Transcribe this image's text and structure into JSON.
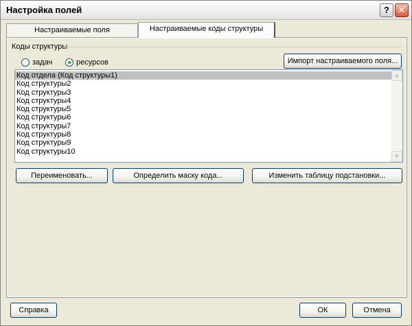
{
  "window": {
    "title": "Настройка полей",
    "help_glyph": "?",
    "close_glyph": "✕"
  },
  "tabs": [
    {
      "label": "Настраиваемые поля",
      "active": false
    },
    {
      "label": "Настраиваемые коды структуры",
      "active": true
    }
  ],
  "group": {
    "label": "Коды структуры"
  },
  "radios": [
    {
      "label": "задач",
      "checked": false
    },
    {
      "label": "ресурсов",
      "checked": true
    }
  ],
  "buttons": {
    "import": "Импорт настраиваемого поля...",
    "rename": "Переименовать...",
    "mask": "Определить маску кода...",
    "lookup": "Изменить таблицу подстановки...",
    "help": "Справка",
    "ok": "ОК",
    "cancel": "Отмена"
  },
  "list": {
    "items": [
      "Код отдела (Код структуры1)",
      "Код структуры2",
      "Код структуры3",
      "Код структуры4",
      "Код структуры5",
      "Код структуры6",
      "Код структуры7",
      "Код структуры8",
      "Код структуры9",
      "Код структуры10"
    ],
    "selected_index": 0
  },
  "icons": {
    "scroll_up": "chevron-up-icon",
    "scroll_down": "chevron-down-icon"
  }
}
